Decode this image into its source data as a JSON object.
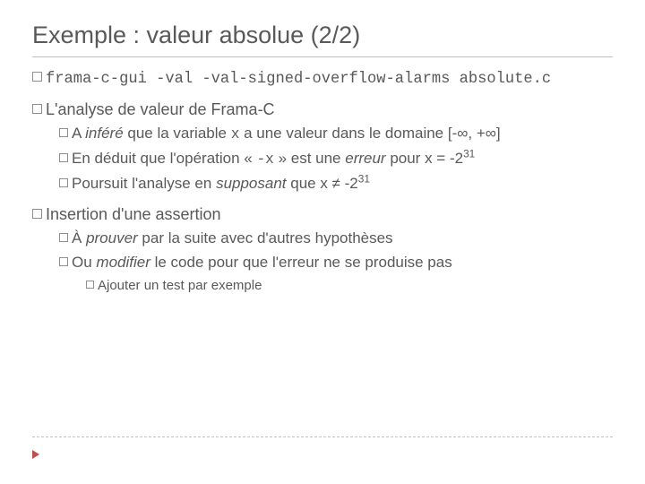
{
  "title": "Exemple : valeur absolue (2/2)",
  "cmd": "frama-c-gui -val -val-signed-overflow-alarms absolute.c",
  "section1": {
    "heading": "L'analyse de valeur de Frama-C",
    "b1_a": "A ",
    "b1_inf": "inféré",
    "b1_b": " que la variable ",
    "b1_x": "x",
    "b1_c": " a une valeur dans le domaine [-∞, +∞]",
    "b2_a": "En déduit que l'opération « ",
    "b2_op": "-x",
    "b2_b": " » est une ",
    "b2_err": "erreur",
    "b2_c": " pour x = -2",
    "b2_exp": "31",
    "b3_a": "Poursuit l'analyse en ",
    "b3_sup": "supposant",
    "b3_b": " que x ≠ -2",
    "b3_exp": "31"
  },
  "section2": {
    "heading": "Insertion d'une assertion",
    "b1_a": "À ",
    "b1_prove": "prouver",
    "b1_b": " par la suite avec d'autres hypothèses",
    "b2_a": "Ou ",
    "b2_mod": "modifier",
    "b2_b": " le code pour que l'erreur ne se produise pas",
    "b2_sub": "Ajouter un test par exemple"
  }
}
